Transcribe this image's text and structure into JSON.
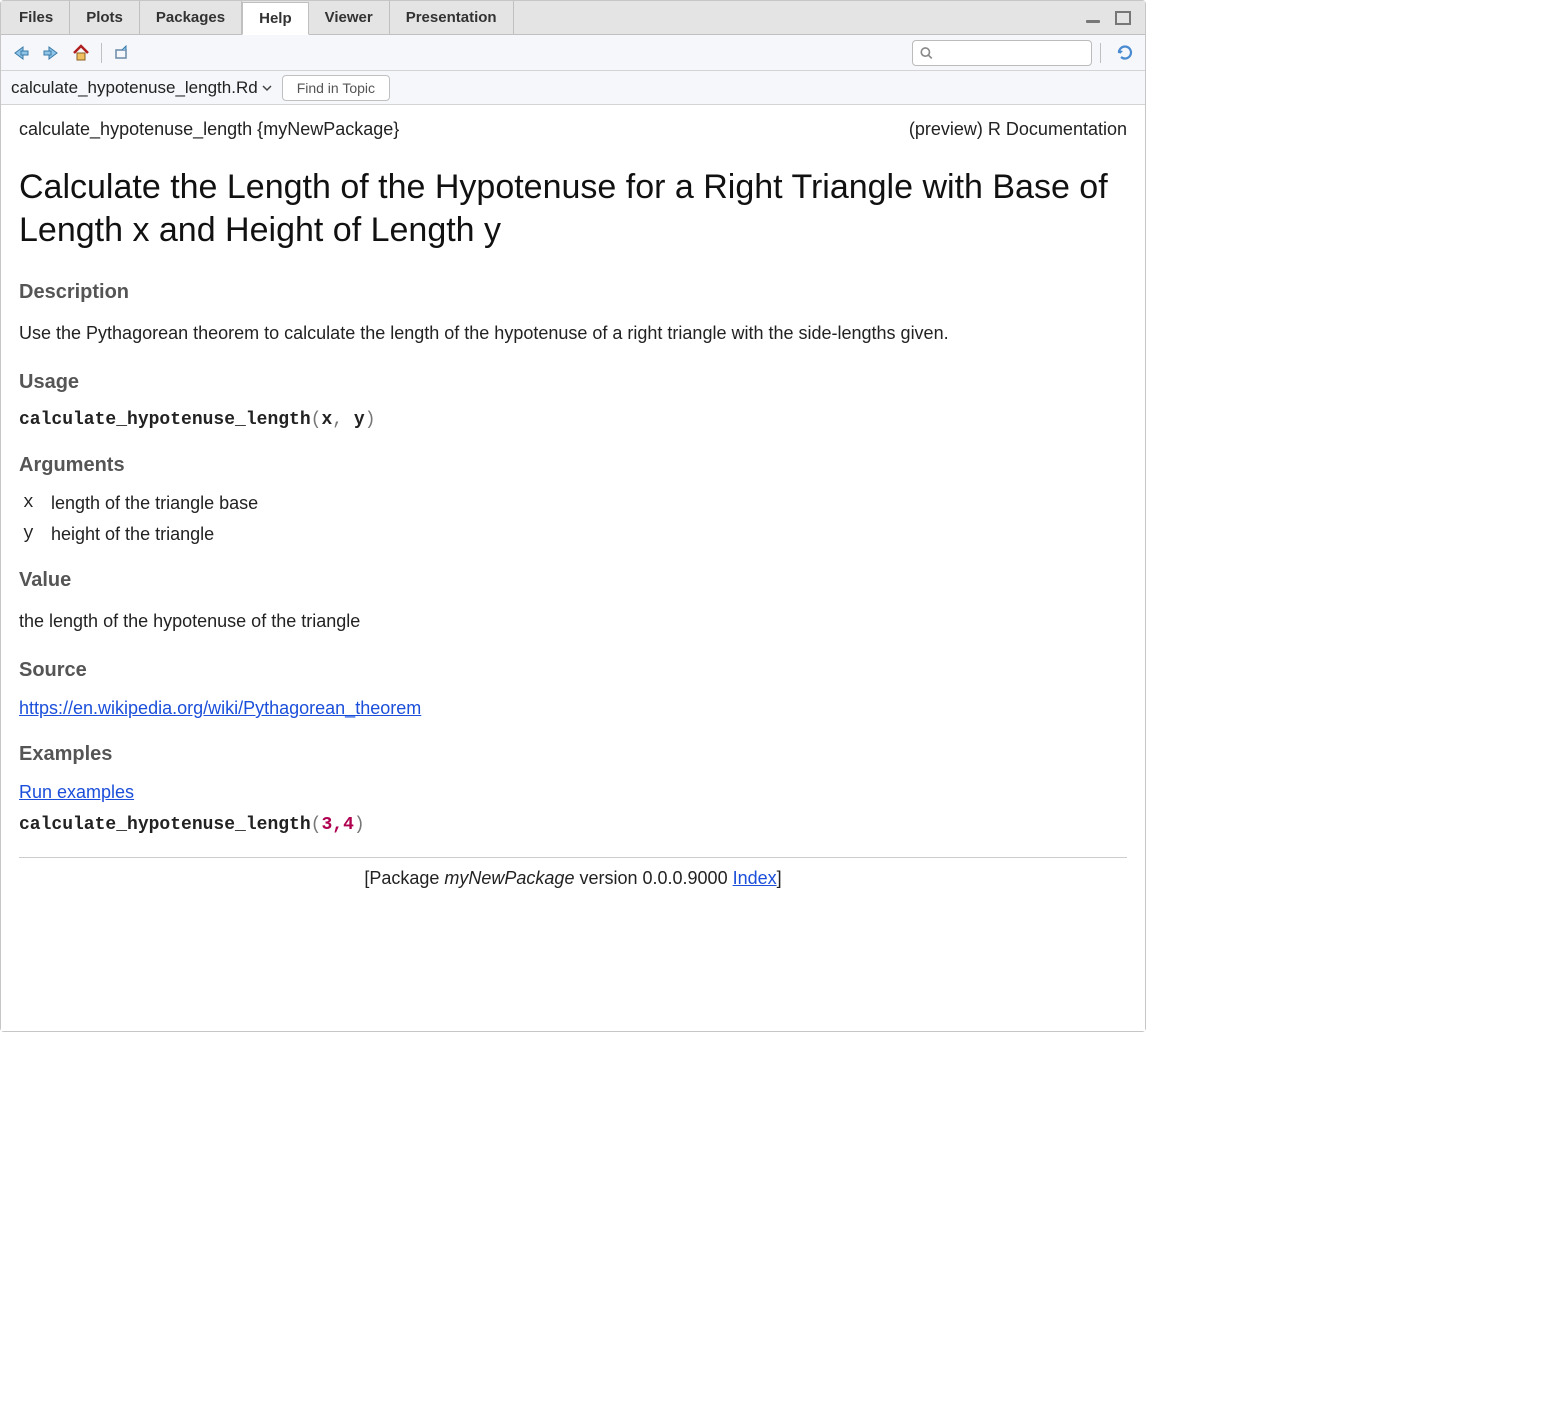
{
  "tabs": [
    {
      "label": "Files"
    },
    {
      "label": "Plots"
    },
    {
      "label": "Packages"
    },
    {
      "label": "Help"
    },
    {
      "label": "Viewer"
    },
    {
      "label": "Presentation"
    }
  ],
  "active_tab": "Help",
  "sub_toolbar": {
    "file_label": "calculate_hypotenuse_length.Rd",
    "find_label": "Find in Topic"
  },
  "doc": {
    "topic_label": "calculate_hypotenuse_length {myNewPackage}",
    "preview_label": "(preview) R Documentation",
    "title": "Calculate the Length of the Hypotenuse for a Right Triangle with Base of Length x and Height of Length y",
    "sections": {
      "description": {
        "heading": "Description",
        "text": "Use the Pythagorean theorem to calculate the length of the hypotenuse of a right triangle with the side-lengths given."
      },
      "usage": {
        "heading": "Usage",
        "fn": "calculate_hypotenuse_length",
        "args": [
          "x",
          "y"
        ]
      },
      "arguments": {
        "heading": "Arguments",
        "items": [
          {
            "name": "x",
            "desc": "length of the triangle base"
          },
          {
            "name": "y",
            "desc": "height of the triangle"
          }
        ]
      },
      "value": {
        "heading": "Value",
        "text": "the length of the hypotenuse of the triangle"
      },
      "source": {
        "heading": "Source",
        "link_text": "https://en.wikipedia.org/wiki/Pythagorean_theorem"
      },
      "examples": {
        "heading": "Examples",
        "run_label": "Run examples",
        "code_fn": "calculate_hypotenuse_length",
        "code_args": [
          "3",
          "4"
        ]
      }
    },
    "footer": {
      "prefix": "[Package ",
      "package": "myNewPackage",
      "mid": " version 0.0.0.9000 ",
      "index_label": "Index",
      "suffix": "]"
    }
  }
}
